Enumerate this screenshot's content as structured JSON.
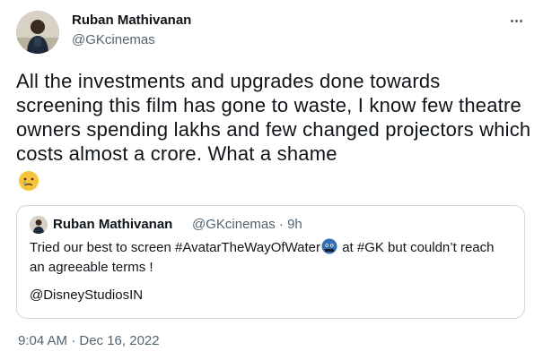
{
  "author": {
    "name": "Ruban Mathivanan",
    "handle": "@GKcinemas"
  },
  "tweet": {
    "text": "All the investments and upgrades done towards screening this film has gone to waste, I know few theatre owners spending lakhs and few changed projectors which costs almost a crore. What a shame",
    "emoji": "crying-face"
  },
  "quoted_tweet": {
    "name": "Ruban Mathivanan",
    "meta": "@GKcinemas · 9h",
    "line1_a": "Tried our best to screen #AvatarTheWayOfWater",
    "line1_b": " at #GK but couldn’t reach",
    "line2": "an agreeable terms !",
    "mention": "@DisneyStudiosIN",
    "emoji": "blue-face-emoji"
  },
  "timestamp": "9:04 AM · Dec 16, 2022",
  "colors": {
    "text": "#0f1419",
    "secondary": "#536471",
    "border": "#cfd9de"
  }
}
